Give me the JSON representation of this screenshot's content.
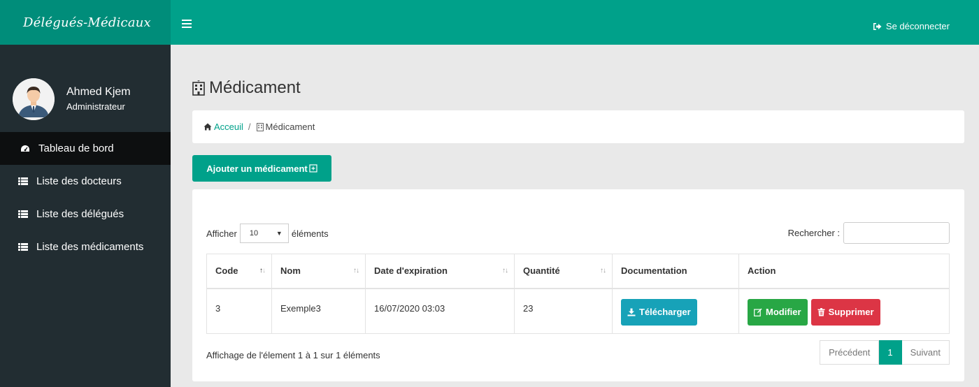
{
  "brand": {
    "title": "Délégués-Médicaux"
  },
  "user": {
    "name": "Ahmed Kjem",
    "role": "Administrateur"
  },
  "sidebar": {
    "items": [
      {
        "label": "Tableau de bord",
        "icon": "dashboard-icon"
      },
      {
        "label": "Liste des docteurs",
        "icon": "list-icon"
      },
      {
        "label": "Liste des délégués",
        "icon": "list-icon"
      },
      {
        "label": "Liste des médicaments",
        "icon": "list-icon"
      }
    ]
  },
  "topbar": {
    "logout_label": "Se déconnecter"
  },
  "page": {
    "title": "Médicament"
  },
  "breadcrumb": {
    "home": "Acceuil",
    "separator": "/",
    "current": "Médicament"
  },
  "actions": {
    "add_label": "Ajouter un médicament"
  },
  "table_controls": {
    "show_label": "Afficher",
    "page_size": "10",
    "entries_label": "éléments",
    "search_label": "Rechercher :"
  },
  "table": {
    "headers": [
      "Code",
      "Nom",
      "Date d'expiration",
      "Quantité",
      "Documentation",
      "Action"
    ],
    "rows": [
      {
        "code": "3",
        "nom": "Exemple3",
        "date": "16/07/2020 03:03",
        "quantite": "23",
        "download_label": "Télécharger",
        "edit_label": "Modifier",
        "delete_label": "Supprimer"
      }
    ]
  },
  "footer": {
    "info": "Affichage de l'élement 1 à 1 sur 1 éléments"
  },
  "pagination": {
    "prev": "Précédent",
    "current": "1",
    "next": "Suivant"
  },
  "colors": {
    "primary": "#00a18a",
    "brand_dark": "#008d7a",
    "sidebar": "#222d32",
    "info": "#17a2b8",
    "success": "#28a745",
    "danger": "#dc3545"
  }
}
